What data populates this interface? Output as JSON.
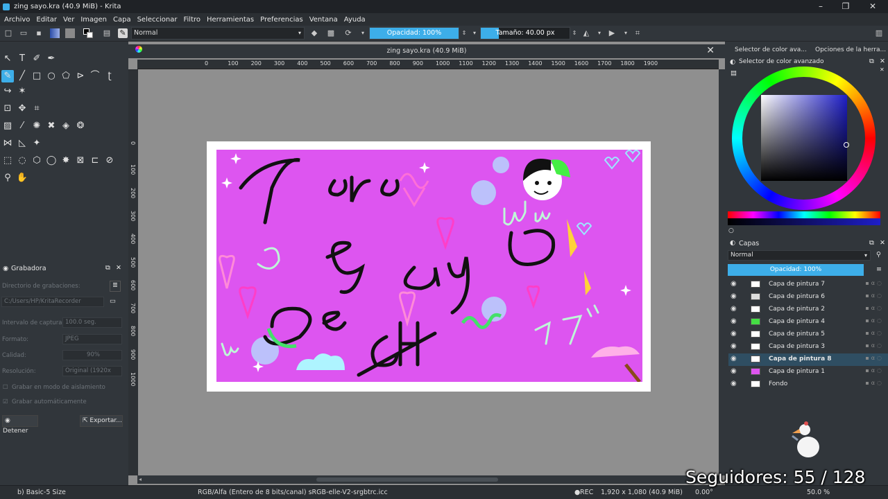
{
  "window": {
    "title": "zing sayo.kra (40.9 MiB)  - Krita"
  },
  "menu": [
    "Archivo",
    "Editar",
    "Ver",
    "Imagen",
    "Capa",
    "Seleccionar",
    "Filtro",
    "Herramientas",
    "Preferencias",
    "Ventana",
    "Ayuda"
  ],
  "toolbar": {
    "blend_mode": "Normal",
    "opacity_label": "Opacidad: 100%",
    "opacity_value": 1.0,
    "size_label": "Tamaño: 40.00 px",
    "size_fill": 0.2
  },
  "document": {
    "tab_title": "zing sayo.kra (40.9 MiB)"
  },
  "ruler": {
    "h_ticks": [
      "0",
      "100",
      "200",
      "300",
      "400",
      "500",
      "600",
      "700",
      "800",
      "900",
      "1000",
      "1100",
      "1200",
      "1300",
      "1400",
      "1500",
      "1600",
      "1700",
      "1800",
      "1900"
    ],
    "v_ticks": [
      "0",
      "100",
      "200",
      "300",
      "400",
      "500",
      "600",
      "700",
      "800",
      "900",
      "1000"
    ]
  },
  "artwork": {
    "text_para": "Para",
    "text_sayo": "Sayo",
    "text_de": "De",
    "text_uwu": "UwU",
    "text_uwu2": "UwU",
    "text_japanese": "ラグ",
    "text_strike": "GHe"
  },
  "recorder": {
    "title": "Grabadora",
    "dir_label": "Directorio de grabaciones:",
    "dir_value": "C:/Users/HP/KritaRecorder",
    "interval_label": "Intervalo de captura:",
    "interval_value": "100.0 seg.",
    "format_label": "Formato:",
    "format_value": "JPEG",
    "quality_label": "Calidad:",
    "quality_value": "90%",
    "resolution_label": "Resolución:",
    "resolution_value": "Original (1920x",
    "isolation_label": "Grabar en modo de aislamiento",
    "auto_label": "Grabar automáticamente",
    "stop_label": "Detener",
    "export_label": "Exportar..."
  },
  "right_tabs": [
    "Selector de color ava...",
    "Opciones de la herra..."
  ],
  "color_selector": {
    "title": "Selector de color avanzado",
    "hue_color": "#1e1ec8"
  },
  "layers": {
    "title": "Capas",
    "blend_mode": "Normal",
    "opacity_label": "Opacidad:  100%",
    "items": [
      {
        "name": "Capa de pintura 7",
        "selected": false
      },
      {
        "name": "Capa de pintura 6",
        "selected": false
      },
      {
        "name": "Capa de pintura 2",
        "selected": false
      },
      {
        "name": "Capa de pintura 4",
        "selected": false
      },
      {
        "name": "Capa de pintura 5",
        "selected": false
      },
      {
        "name": "Capa de pintura 3",
        "selected": false
      },
      {
        "name": "Capa de pintura 8",
        "selected": true
      },
      {
        "name": "Capa de pintura 1",
        "selected": false
      },
      {
        "name": "Fondo",
        "selected": false
      }
    ]
  },
  "status": {
    "brush": "b) Basic-5 Size",
    "color_model": "RGB/Alfa (Entero de 8 bits/canal)  sRGB-elle-V2-srgbtrc.icc",
    "rec": "REC",
    "dimensions": "1,920 x 1,080 (40.9 MiB)",
    "rotation": "0.00°",
    "zoom": "50.0 %"
  },
  "overlay": {
    "followers": "Seguidores: 55 / 128"
  }
}
